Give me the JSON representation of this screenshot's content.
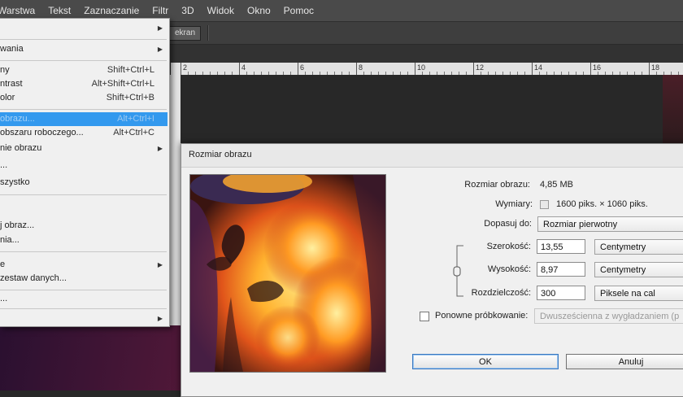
{
  "menubar": {
    "items": [
      "Warstwa",
      "Tekst",
      "Zaznaczanie",
      "Filtr",
      "3D",
      "Widok",
      "Okno",
      "Pomoc"
    ]
  },
  "optionsbar": {
    "button_label": "ekran"
  },
  "ruler": {
    "labels": [
      "2",
      "4",
      "6",
      "8",
      "10",
      "12",
      "14",
      "16",
      "18"
    ]
  },
  "dropdown_menu": {
    "items": [
      {
        "label": "",
        "shortcut": "",
        "submenu": true
      },
      {
        "label": "wania",
        "shortcut": "",
        "submenu": true
      },
      {
        "label": "ny",
        "shortcut": "Shift+Ctrl+L",
        "submenu": false
      },
      {
        "label": "ntrast",
        "shortcut": "Alt+Shift+Ctrl+L",
        "submenu": false
      },
      {
        "label": "olor",
        "shortcut": "Shift+Ctrl+B",
        "submenu": false
      },
      {
        "label": "obrazu...",
        "shortcut": "Alt+Ctrl+I",
        "submenu": false
      },
      {
        "label": "obszaru roboczego...",
        "shortcut": "Alt+Ctrl+C",
        "submenu": false
      },
      {
        "label": "nie obrazu",
        "shortcut": "",
        "submenu": true
      },
      {
        "label": "...",
        "shortcut": "",
        "submenu": false
      },
      {
        "label": "szystko",
        "shortcut": "",
        "submenu": false
      },
      {
        "label": "",
        "shortcut": "",
        "submenu": false
      },
      {
        "label": "j obraz...",
        "shortcut": "",
        "submenu": false
      },
      {
        "label": "nia...",
        "shortcut": "",
        "submenu": false
      },
      {
        "label": "e",
        "shortcut": "",
        "submenu": true
      },
      {
        "label": "zestaw danych...",
        "shortcut": "",
        "submenu": false
      },
      {
        "label": "...",
        "shortcut": "",
        "submenu": false
      },
      {
        "label": "",
        "shortcut": "",
        "submenu": true
      }
    ]
  },
  "dialog": {
    "title": "Rozmiar obrazu",
    "image_size_label": "Rozmiar obrazu:",
    "image_size_value": "4,85 MB",
    "dimensions_label": "Wymiary:",
    "dimensions_value": "1600 piks. × 1060 piks.",
    "fit_label": "Dopasuj do:",
    "fit_value": "Rozmiar pierwotny",
    "width_label": "Szerokość:",
    "width_value": "13,55",
    "width_unit": "Centymetry",
    "height_label": "Wysokość:",
    "height_value": "8,97",
    "height_unit": "Centymetry",
    "resolution_label": "Rozdzielczość:",
    "resolution_value": "300",
    "resolution_unit": "Piksele na cal",
    "resample_label": "Ponowne próbkowanie:",
    "resample_checked": false,
    "resample_value": "Dwusześcienna z wygładzaniem (p",
    "ok_label": "OK",
    "cancel_label": "Anuluj"
  },
  "colors": {
    "highlight": "#3399ee",
    "menubar": "#4a4a4a",
    "workspace": "#282828"
  }
}
